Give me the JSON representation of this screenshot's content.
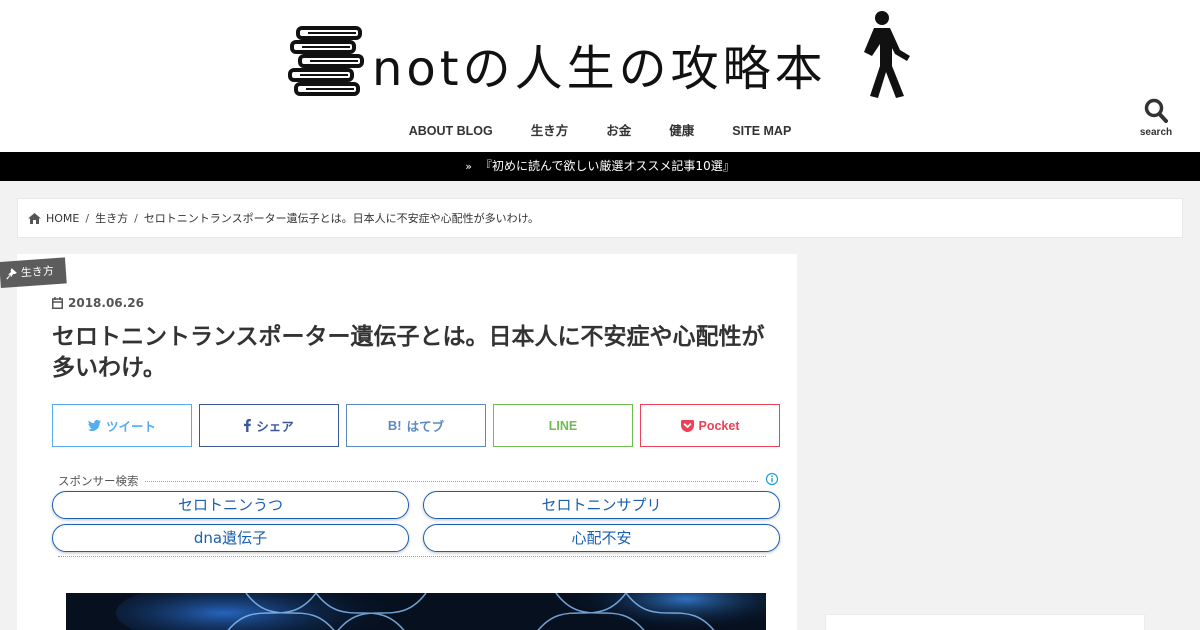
{
  "site": {
    "logo_text": "notの人生の攻略本"
  },
  "nav": {
    "items": [
      {
        "label": "ABOUT BLOG"
      },
      {
        "label": "生き方"
      },
      {
        "label": "お金"
      },
      {
        "label": "健康"
      },
      {
        "label": "SITE MAP"
      }
    ],
    "search_label": "search"
  },
  "notice": {
    "text": "『初めに読んで欲しい厳選オススメ記事10選』"
  },
  "breadcrumb": {
    "home": "HOME",
    "category": "生き方",
    "current": "セロトニントランスポーター遺伝子とは。日本人に不安症や心配性が多いわけ。"
  },
  "article": {
    "category": "生き方",
    "date": "2018.06.26",
    "title": "セロトニントランスポーター遺伝子とは。日本人に不安症や心配性が多いわけ。"
  },
  "share": {
    "twitter": "ツイート",
    "facebook": "シェア",
    "hatena_mark": "B!",
    "hatena": "はてブ",
    "line": "LINE",
    "pocket": "Pocket"
  },
  "sponsor": {
    "heading": "スポンサー検索",
    "keywords": [
      "セロトニンうつ",
      "セロトニンサプリ",
      "dna遺伝子",
      "心配不安"
    ]
  },
  "colors": {
    "twitter": "#55acee",
    "facebook": "#3b5998",
    "hatena": "#5d8ac1",
    "line": "#6fbd50",
    "pocket": "#ee4056",
    "notice_bg": "#000000",
    "keyword": "#1a5fb4"
  }
}
